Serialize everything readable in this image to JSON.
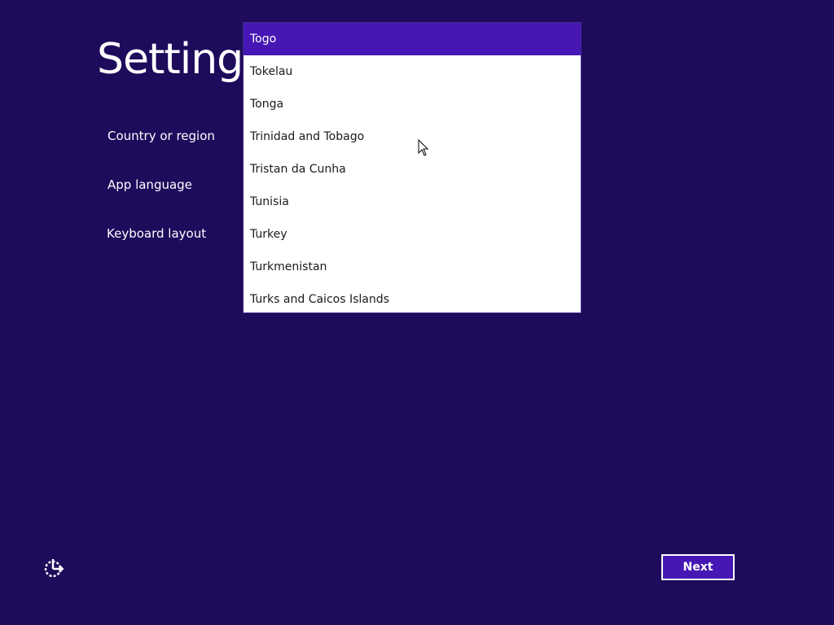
{
  "page": {
    "title": "Settings",
    "background_color": "#1e0b5c",
    "accent_color": "#4617b4"
  },
  "settings": {
    "country_label": "Country or region",
    "app_language_label": "App language",
    "keyboard_label": "Keyboard layout"
  },
  "country_dropdown": {
    "selected": "Togo",
    "options": [
      "Togo",
      "Tokelau",
      "Tonga",
      "Trinidad and Tobago",
      "Tristan da Cunha",
      "Tunisia",
      "Turkey",
      "Turkmenistan",
      "Turks and Caicos Islands"
    ]
  },
  "footer": {
    "ease_of_access_icon": "ease-of-access-icon",
    "next_label": "Next"
  }
}
